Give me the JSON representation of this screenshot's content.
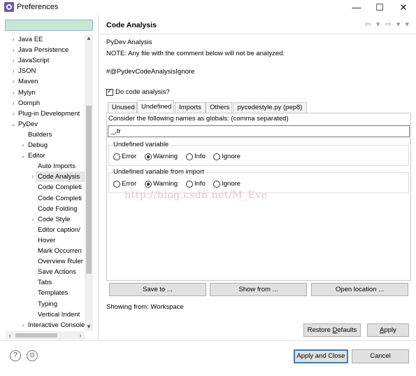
{
  "window": {
    "title": "Preferences",
    "minimize": "—",
    "maximize": "☐",
    "close": "✕"
  },
  "filter": {
    "value": ""
  },
  "tree": [
    {
      "label": "Java EE",
      "level": 0,
      "arrow": "›"
    },
    {
      "label": "Java Persistence",
      "level": 0,
      "arrow": "›"
    },
    {
      "label": "JavaScript",
      "level": 0,
      "arrow": "›"
    },
    {
      "label": "JSON",
      "level": 0,
      "arrow": "›"
    },
    {
      "label": "Maven",
      "level": 0,
      "arrow": "›"
    },
    {
      "label": "Mylyn",
      "level": 0,
      "arrow": "›"
    },
    {
      "label": "Oomph",
      "level": 0,
      "arrow": "›"
    },
    {
      "label": "Plug-in Development",
      "level": 0,
      "arrow": "›"
    },
    {
      "label": "PyDev",
      "level": 0,
      "arrow": "⌄"
    },
    {
      "label": "Builders",
      "level": 1,
      "arrow": ""
    },
    {
      "label": "Debug",
      "level": 1,
      "arrow": "›"
    },
    {
      "label": "Editor",
      "level": 1,
      "arrow": "⌄"
    },
    {
      "label": "Auto Imports",
      "level": 2,
      "arrow": ""
    },
    {
      "label": "Code Analysis",
      "level": 2,
      "arrow": "›",
      "selected": true
    },
    {
      "label": "Code Completi",
      "level": 2,
      "arrow": ""
    },
    {
      "label": "Code Completi",
      "level": 2,
      "arrow": ""
    },
    {
      "label": "Code Folding",
      "level": 2,
      "arrow": ""
    },
    {
      "label": "Code Style",
      "level": 2,
      "arrow": "›"
    },
    {
      "label": "Editor caption/",
      "level": 2,
      "arrow": ""
    },
    {
      "label": "Hover",
      "level": 2,
      "arrow": ""
    },
    {
      "label": "Mark Occurren",
      "level": 2,
      "arrow": ""
    },
    {
      "label": "Overview Ruler",
      "level": 2,
      "arrow": ""
    },
    {
      "label": "Save Actions",
      "level": 2,
      "arrow": ""
    },
    {
      "label": "Tabs",
      "level": 2,
      "arrow": ""
    },
    {
      "label": "Templates",
      "level": 2,
      "arrow": ""
    },
    {
      "label": "Typing",
      "level": 2,
      "arrow": ""
    },
    {
      "label": "Vertical Indent",
      "level": 2,
      "arrow": ""
    },
    {
      "label": "Interactive Console",
      "level": 1,
      "arrow": "›"
    }
  ],
  "page": {
    "title": "Code Analysis",
    "nav_icons": "⇦ ▾ ⇨ ▾ ▾",
    "subtitle": "PyDev Analysis",
    "note": "NOTE: Any file with the comment below will not be analyzed.",
    "ignore_comment": "#@PydevCodeAnalysisIgnore",
    "do_code_analysis": "Do code analysis?",
    "tabs": [
      "Unused",
      "Undefined",
      "Imports",
      "Others",
      "pycodestyle.py (pep8)"
    ],
    "active_tab": "Undefined",
    "globals_label": "Consider the following names as globals: (comma separated)",
    "globals_value": "_,tr",
    "groups": [
      {
        "title": "Undefined variable",
        "options": [
          "Error",
          "Warning",
          "Info",
          "Ignore"
        ],
        "selected": "Warning"
      },
      {
        "title": "Undefined variable from import",
        "options": [
          "Error",
          "Warning",
          "Info",
          "Ignore"
        ],
        "selected": "Warning"
      }
    ],
    "buttons": {
      "save_to": "Save to ...",
      "show_from": "Show from ...",
      "open_location": "Open location ..."
    },
    "showing_from": "Showing from: Workspace",
    "restore_defaults_pre": "Restore ",
    "restore_defaults_u": "D",
    "restore_defaults_post": "efaults",
    "apply_pre": "",
    "apply_u": "A",
    "apply_post": "pply"
  },
  "watermark": "http://blog.csdn.net/M_Eve",
  "bottom": {
    "help_icon": "?",
    "import_icon": "⊙",
    "apply_close": "Apply and Close",
    "cancel": "Cancel"
  }
}
